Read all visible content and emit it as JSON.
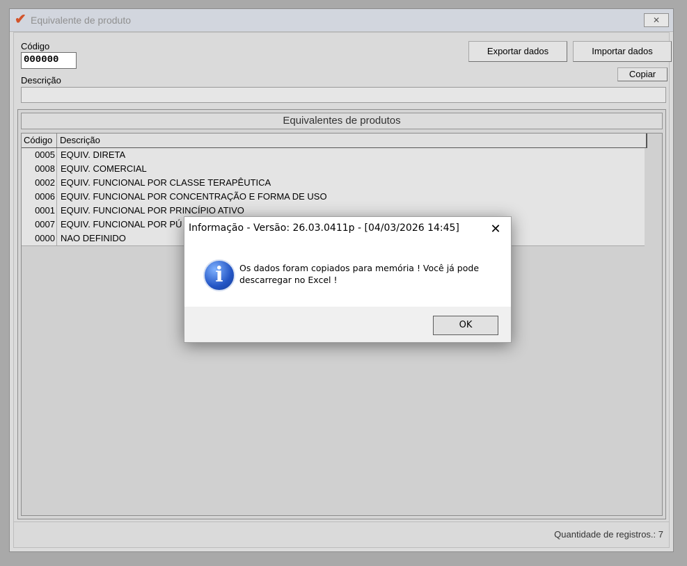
{
  "window": {
    "title": "Equivalente de produto",
    "close_glyph": "✕"
  },
  "form": {
    "codigo_label": "Código",
    "codigo_value": "000000",
    "descricao_label": "Descrição",
    "descricao_value": ""
  },
  "toolbar": {
    "export_label": "Exportar dados",
    "import_label": "Importar dados",
    "copy_label": "Copiar"
  },
  "grid": {
    "caption": "Equivalentes de produtos",
    "columns": [
      "Código",
      "Descrição"
    ],
    "rows": [
      {
        "code": "0005",
        "desc": "EQUIV.  DIRETA"
      },
      {
        "code": "0008",
        "desc": "EQUIV. COMERCIAL"
      },
      {
        "code": "0002",
        "desc": "EQUIV. FUNCIONAL POR CLASSE TERAPÊUTICA"
      },
      {
        "code": "0006",
        "desc": "EQUIV. FUNCIONAL POR CONCENTRAÇÃO E FORMA DE USO"
      },
      {
        "code": "0001",
        "desc": "EQUIV. FUNCIONAL POR PRINCÍPIO ATIVO"
      },
      {
        "code": "0007",
        "desc": "EQUIV. FUNCIONAL POR PÚ"
      },
      {
        "code": "0000",
        "desc": "NAO DEFINIDO"
      }
    ]
  },
  "status": {
    "record_count": "Quantidade de registros.: 7"
  },
  "dialog": {
    "title": "Informação - Versão: 26.03.0411p - [04/03/2026 14:45]",
    "close_glyph": "✕",
    "icon": "info-icon",
    "icon_glyph": "i",
    "message_line1": "Os dados foram copiados para memória ! Você já pode",
    "message_line2": "descarregar no Excel !",
    "ok_label": "OK"
  },
  "colors": {
    "desktop": "#a9a9a9",
    "window_bg": "#dcdcdc",
    "info_icon_blue": "#2355c4",
    "app_icon_red": "#d2542b"
  }
}
